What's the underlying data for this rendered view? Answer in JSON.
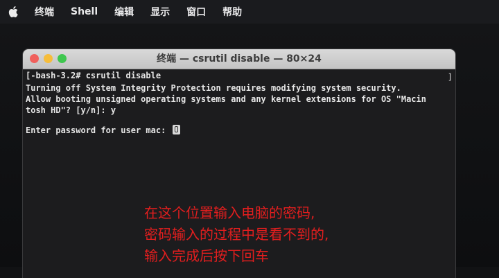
{
  "menubar": {
    "items": [
      "终端",
      "Shell",
      "编辑",
      "显示",
      "窗口",
      "帮助"
    ]
  },
  "window": {
    "title": "终端 — csrutil disable — 80×24"
  },
  "terminal": {
    "lines": [
      "[-bash-3.2# csrutil disable",
      "Turning off System Integrity Protection requires modifying system security.",
      "Allow booting unsigned operating systems and any kernel extensions for OS \"Macin",
      "tosh HD\"? [y/n]: y",
      "Enter password for user mac: "
    ],
    "scroll_marker": "]"
  },
  "annotation": {
    "lines": [
      "在这个位置输入电脑的密码,",
      "密码输入的过程中是看不到的,",
      "输入完成后按下回车"
    ]
  }
}
